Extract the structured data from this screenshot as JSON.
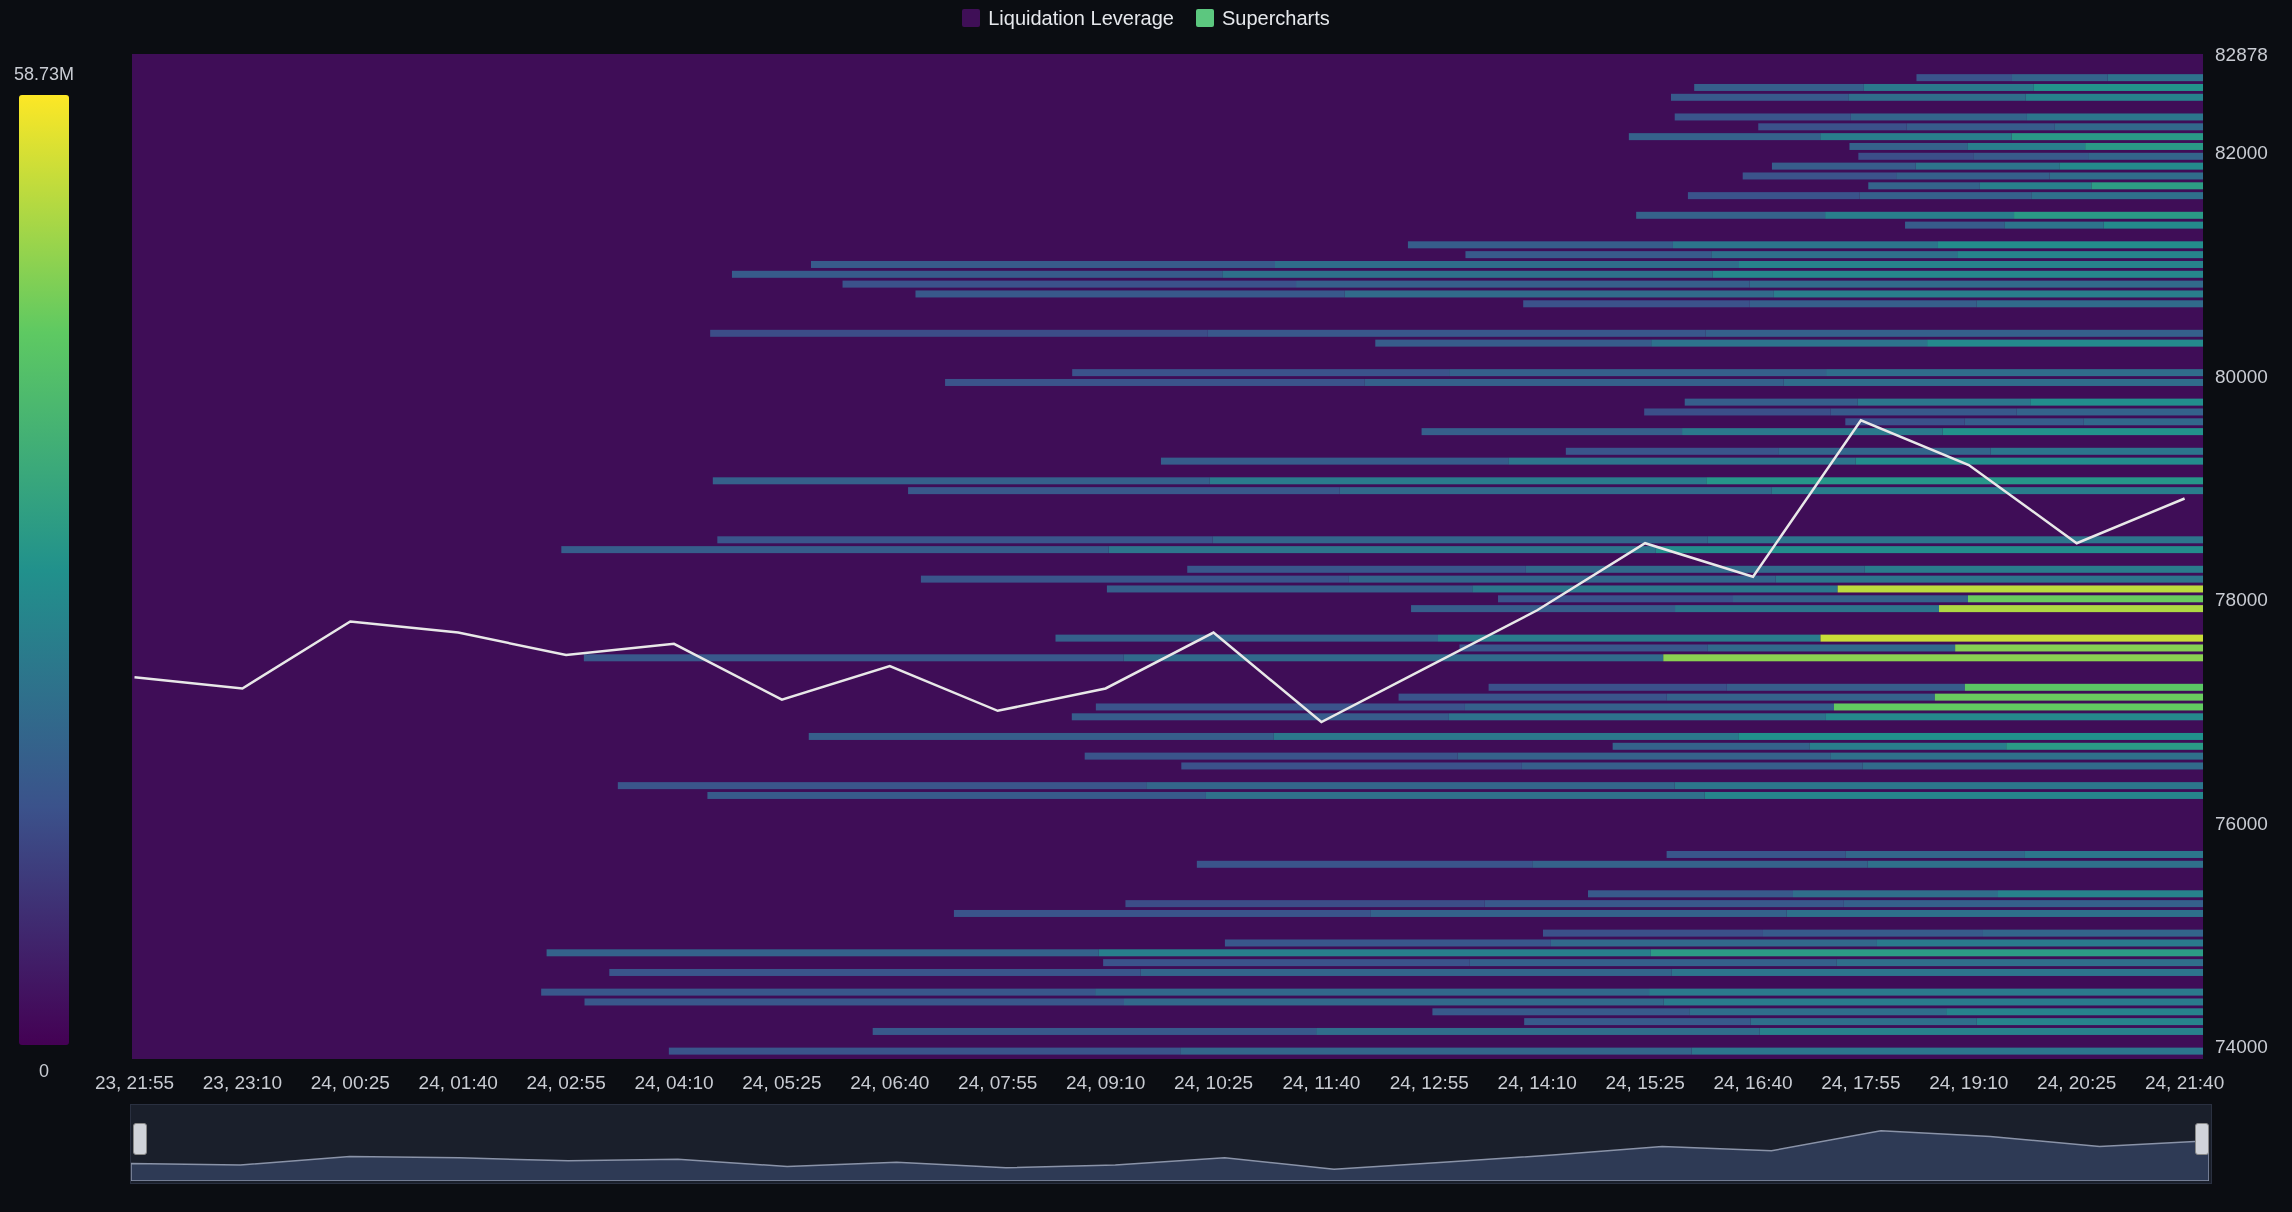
{
  "legend": {
    "items": [
      {
        "label": "Liquidation Leverage",
        "color": "#3f0f57"
      },
      {
        "label": "Supercharts",
        "color": "#5cc77f"
      }
    ]
  },
  "color_scale": {
    "max_label": "58.73M",
    "min_label": "0"
  },
  "chart": {
    "chart_data": {
      "type": "line",
      "categories": [
        "23, 21:55",
        "23, 23:10",
        "24, 00:25",
        "24, 01:40",
        "24, 02:55",
        "24, 04:10",
        "24, 05:25",
        "24, 06:40",
        "24, 07:55",
        "24, 09:10",
        "24, 10:25",
        "24, 11:40",
        "24, 12:55",
        "24, 14:10",
        "24, 15:25",
        "24, 16:40",
        "24, 17:55",
        "24, 19:10",
        "24, 20:25",
        "24, 21:40"
      ],
      "values": [
        77300,
        77200,
        77800,
        77700,
        77500,
        77600,
        77100,
        77400,
        77000,
        77200,
        77700,
        76900,
        77400,
        77900,
        78500,
        78200,
        79600,
        79200,
        78500,
        78900
      ],
      "ylim": [
        73884,
        82878
      ],
      "yticks": [
        74000,
        76000,
        78000,
        80000,
        82000,
        82878
      ]
    }
  }
}
